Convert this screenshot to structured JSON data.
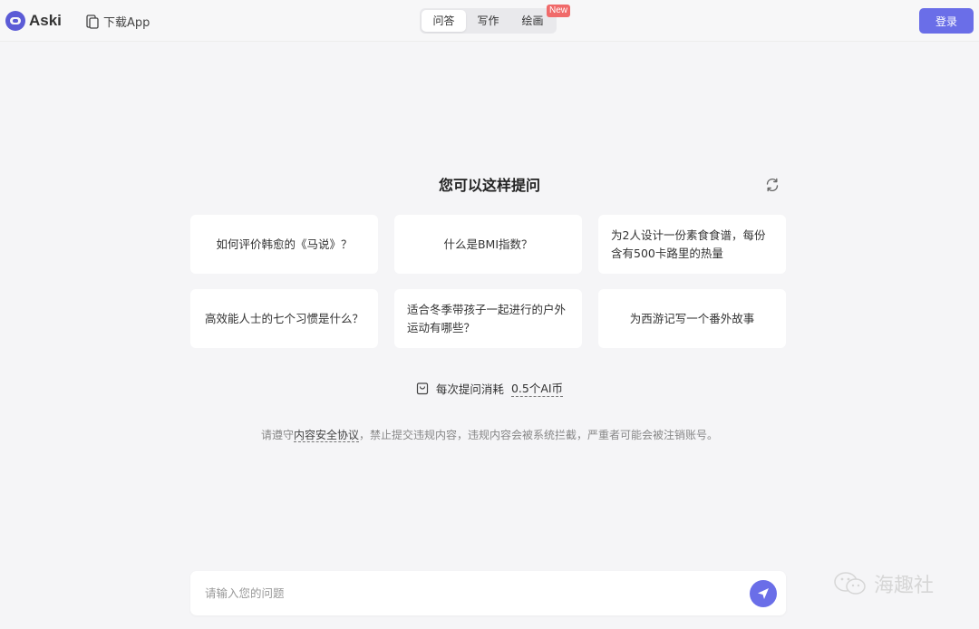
{
  "header": {
    "logo_text": "Aski",
    "download_label": "下载App",
    "tabs": [
      {
        "label": "问答",
        "active": true
      },
      {
        "label": "写作",
        "active": false
      },
      {
        "label": "绘画",
        "active": false
      }
    ],
    "new_badge": "New",
    "login_label": "登录"
  },
  "main": {
    "title": "您可以这样提问",
    "suggestions": [
      {
        "text": "如何评价韩愈的《马说》？"
      },
      {
        "text": "什么是BMI指数？"
      },
      {
        "text": "为2人设计一份素食食谱，每份含有500卡路里的热量"
      },
      {
        "text": "高效能人士的七个习惯是什么？"
      },
      {
        "text": "适合冬季带孩子一起进行的户外运动有哪些？"
      },
      {
        "text": "为西游记写一个番外故事"
      }
    ],
    "cost": {
      "prefix": "每次提问消耗",
      "amount": "0.5个AI币"
    },
    "notice": {
      "prefix": "请遵守",
      "link": "内容安全协议",
      "suffix": "，禁止提交违规内容，违规内容会被系统拦截，严重者可能会被注销账号。"
    }
  },
  "input": {
    "placeholder": "请输入您的问题"
  },
  "watermark": "海趣社",
  "colors": {
    "accent": "#6a6ee8",
    "badge": "#f06a6a",
    "background": "#f5f5f7"
  }
}
